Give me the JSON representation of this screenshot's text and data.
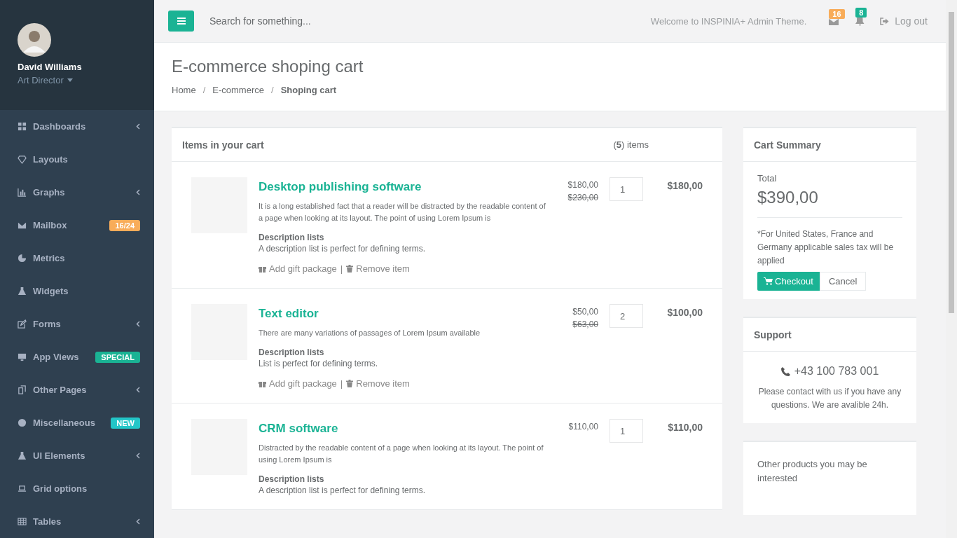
{
  "profile": {
    "name": "David Williams",
    "role": "Art Director"
  },
  "nav": [
    {
      "label": "Dashboards",
      "arrow": true
    },
    {
      "label": "Layouts",
      "arrow": false
    },
    {
      "label": "Graphs",
      "arrow": true
    },
    {
      "label": "Mailbox",
      "arrow": false,
      "badge": {
        "text": "16/24",
        "color": "#f8ac59"
      }
    },
    {
      "label": "Metrics",
      "arrow": false
    },
    {
      "label": "Widgets",
      "arrow": false
    },
    {
      "label": "Forms",
      "arrow": true
    },
    {
      "label": "App Views",
      "arrow": false,
      "badge": {
        "text": "SPECIAL",
        "color": "#1ab394"
      }
    },
    {
      "label": "Other Pages",
      "arrow": true
    },
    {
      "label": "Miscellaneous",
      "arrow": false,
      "badge": {
        "text": "NEW",
        "color": "#23c6c8"
      }
    },
    {
      "label": "UI Elements",
      "arrow": true
    },
    {
      "label": "Grid options",
      "arrow": false
    },
    {
      "label": "Tables",
      "arrow": true
    }
  ],
  "topbar": {
    "search_placeholder": "Search for something...",
    "welcome": "Welcome to INSPINIA+ Admin Theme.",
    "mail_count": "16",
    "alert_count": "8",
    "logout": "Log out"
  },
  "heading": {
    "title": "E-commerce shoping cart",
    "separator": "/",
    "breadcrumb": [
      {
        "label": "Home",
        "selected": false
      },
      {
        "label": "E-commerce",
        "selected": false
      },
      {
        "label": "Shoping cart",
        "selected": true
      }
    ]
  },
  "cart": {
    "title": "Items in your cart",
    "count": "(**5**) items",
    "items": [
      {
        "name": "Desktop publishing software",
        "description": "It is a long established fact that a reader will be distracted by the readable content of a page when looking at its layout. The point of using Lorem Ipsum is",
        "dl_title": "Description lists",
        "dl_text": "A description list is perfect for defining terms.",
        "price": "$180,00",
        "old_price": "$230,00",
        "quantity": "1",
        "total": "$180,00",
        "actions": [
          "Add gift package",
          "Remove item"
        ],
        "action_separator": "|"
      },
      {
        "name": "Text editor",
        "description": "There are many variations of passages of Lorem Ipsum available",
        "dl_title": "Description lists",
        "dl_text": "List is perfect for defining terms.",
        "price": "$50,00",
        "old_price": "$63,00",
        "quantity": "2",
        "total": "$100,00",
        "actions": [
          "Add gift package",
          "Remove item"
        ],
        "action_separator": "|"
      },
      {
        "name": "CRM software",
        "description": "Distracted by the readable content of a page when looking at its layout. The point of using Lorem Ipsum is",
        "dl_title": "Description lists",
        "dl_text": "A description list is perfect for defining terms.",
        "price": "$110,00",
        "quantity": "1",
        "total": "$110,00"
      }
    ]
  },
  "summary": {
    "title": "Cart Summary",
    "total_label": "Total",
    "total": "$390,00",
    "note": "*For United States, France and Germany applicable sales tax will be applied",
    "checkout": "Checkout",
    "cancel": "Cancel"
  },
  "support": {
    "title": "Support",
    "phone": "+43 100 783 001",
    "text": "Please contact with us if you have any questions. We are avalible 24h."
  },
  "other": {
    "title": "Other products you may be interested"
  }
}
